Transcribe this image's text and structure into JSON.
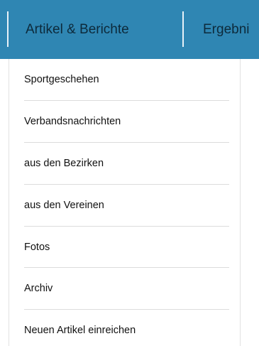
{
  "nav": {
    "active_label": "Artikel & Berichte",
    "next_label": "Ergebni"
  },
  "menu": {
    "items": [
      {
        "label": "Sportgeschehen"
      },
      {
        "label": "Verbandsnachrichten"
      },
      {
        "label": "aus den Bezirken"
      },
      {
        "label": "aus den Vereinen"
      },
      {
        "label": "Fotos"
      },
      {
        "label": "Archiv"
      },
      {
        "label": "Neuen Artikel einreichen"
      }
    ]
  },
  "colors": {
    "navbar_bg": "#2f86b3",
    "nav_text": "#0d2a3b",
    "menu_text": "#111111",
    "divider": "#dcdcdc"
  }
}
